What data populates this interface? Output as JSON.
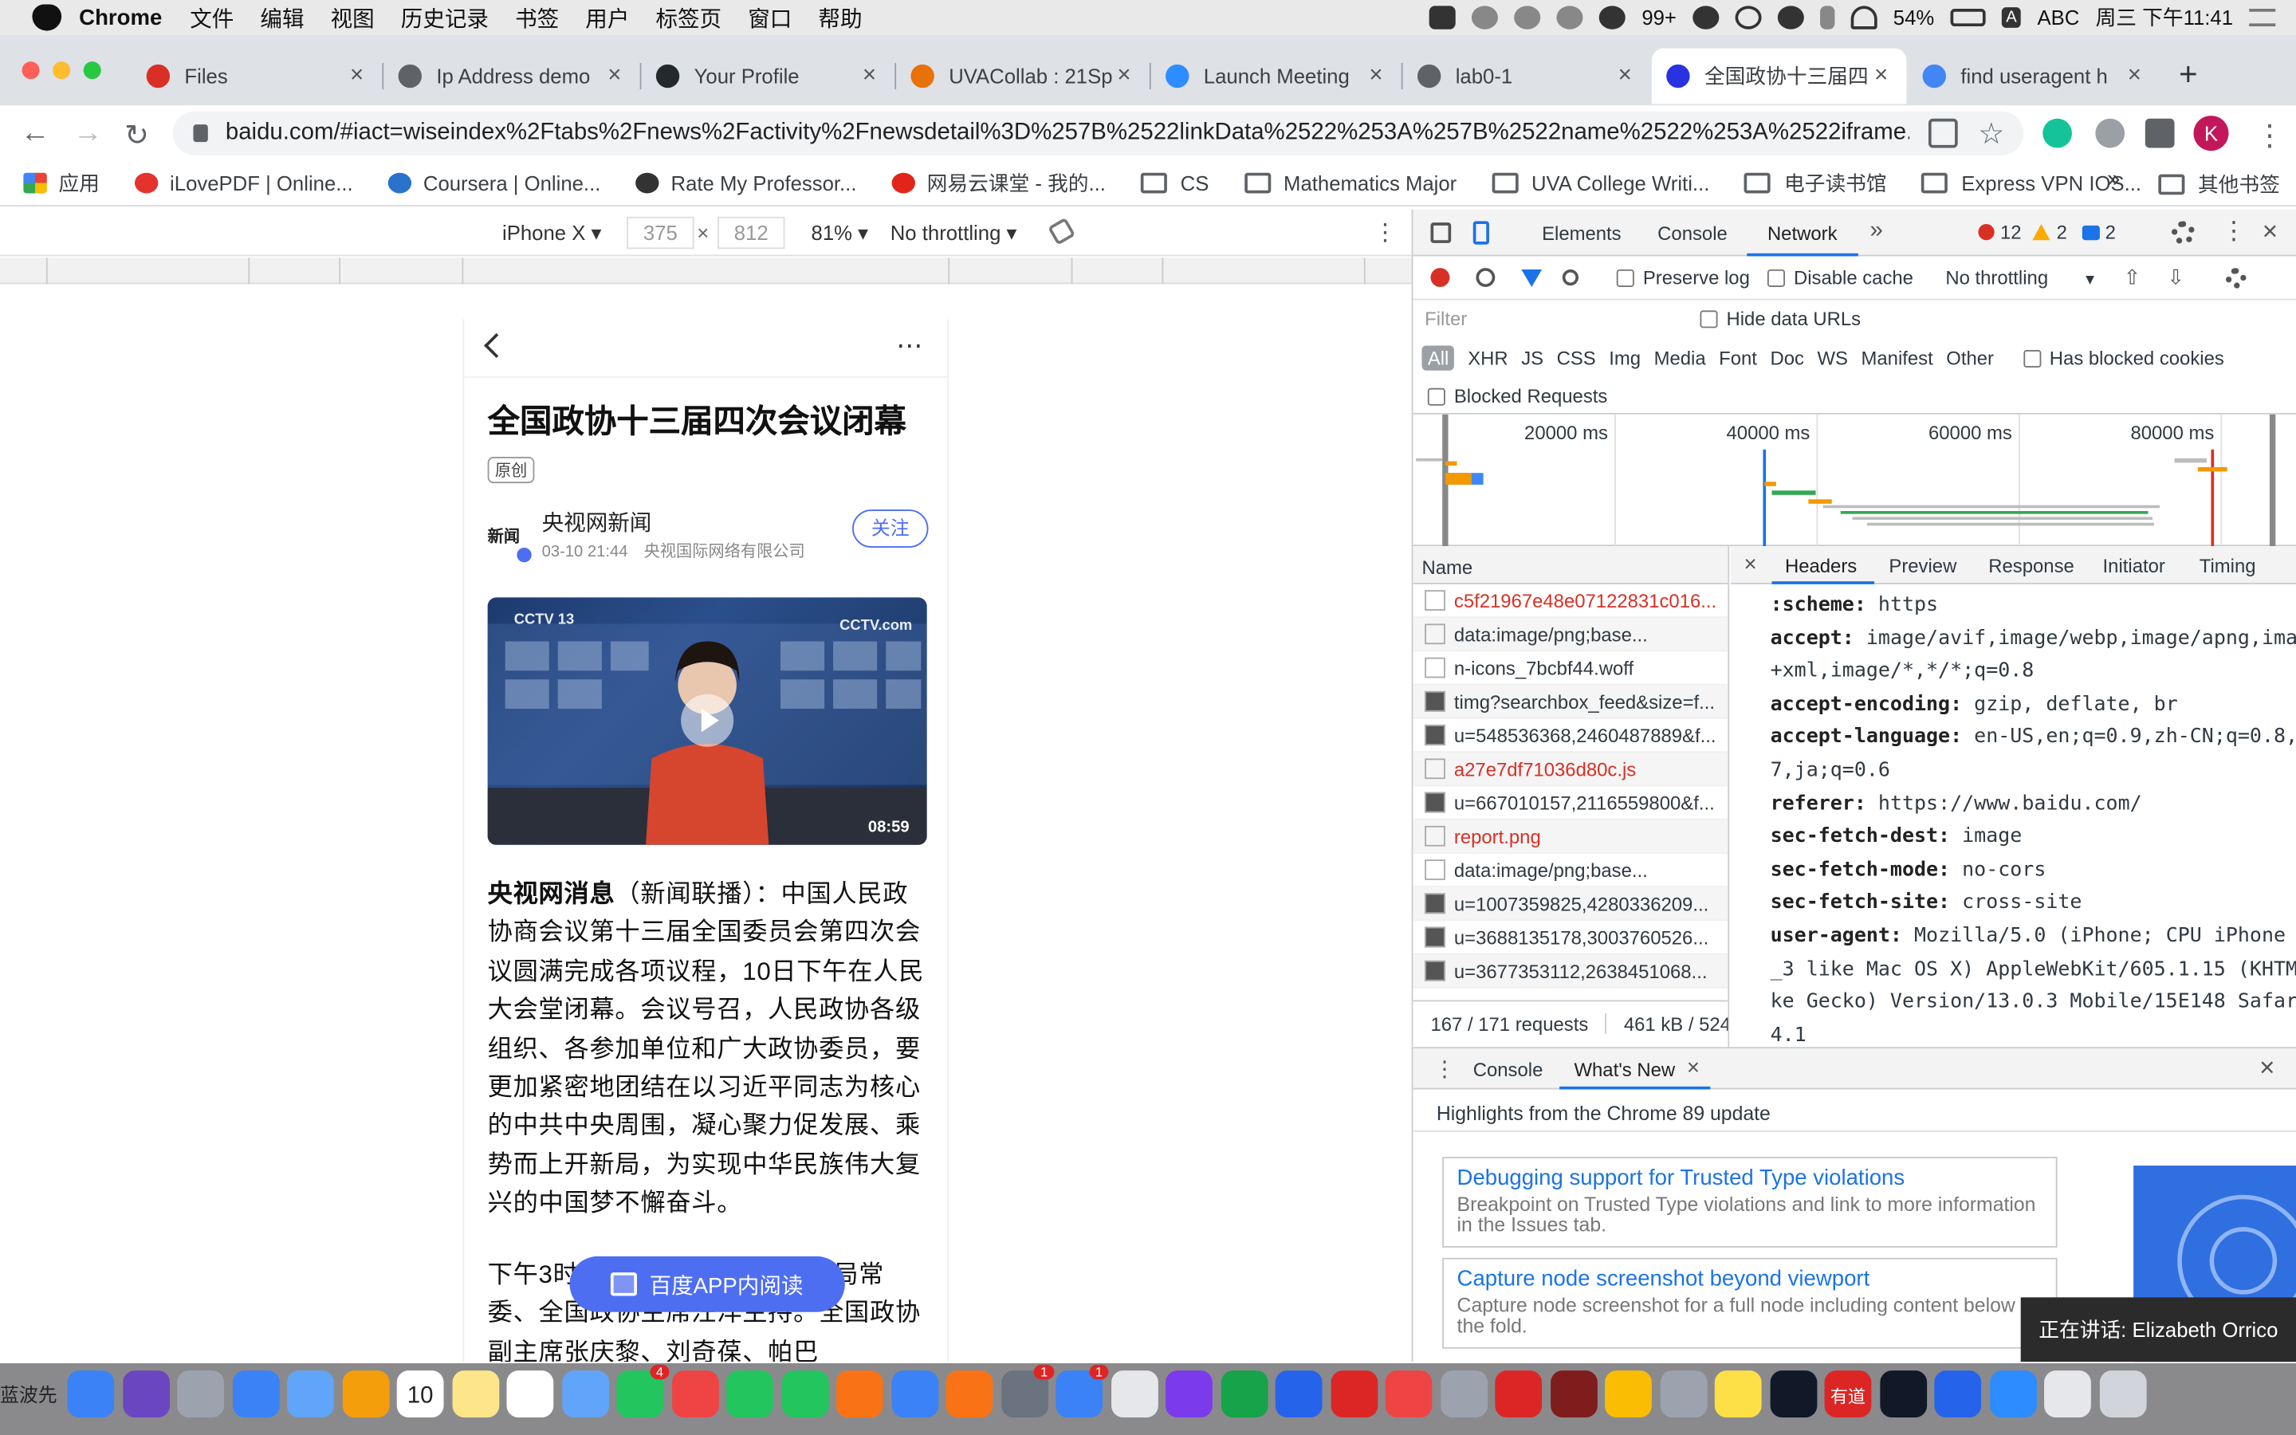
{
  "menubar": {
    "app": "Chrome",
    "items": [
      "文件",
      "编辑",
      "视图",
      "历史记录",
      "书签",
      "用户",
      "标签页",
      "窗口",
      "帮助"
    ],
    "wechat_badge": "99+",
    "battery": "54%",
    "input_method": "ABC",
    "clock": "周三 下午11:41"
  },
  "tabs": [
    {
      "title": "Files",
      "color": "#d93025"
    },
    {
      "title": "Ip Address demo",
      "color": "#5f6368"
    },
    {
      "title": "Your Profile",
      "color": "#24292e"
    },
    {
      "title": "UVACollab : 21Sp",
      "color": "#e8710a"
    },
    {
      "title": "Launch Meeting",
      "color": "#2d8cff"
    },
    {
      "title": "lab0-1",
      "color": "#5f6368"
    },
    {
      "title": "全国政协十三届四",
      "color": "#2932e1"
    },
    {
      "title": "find useragent h",
      "color": "#4285f4"
    }
  ],
  "omnibox": {
    "url": "baidu.com/#iact=wiseindex%2Ftabs%2Fnews%2Factivity%2Fnewsdetail%3D%257B%2522linkData%2522%253A%257B%2522name%2522%253A%2522iframe..."
  },
  "profile_initial": "K",
  "bookmarks": [
    {
      "label": "应用",
      "type": "apps"
    },
    {
      "label": "iLovePDF | Online...",
      "type": "site",
      "color": "#e5322d"
    },
    {
      "label": "Coursera | Online...",
      "type": "site",
      "color": "#2a73cc"
    },
    {
      "label": "Rate My Professor...",
      "type": "site",
      "color": "#333333"
    },
    {
      "label": "网易云课堂 - 我的...",
      "type": "site",
      "color": "#e1251b"
    },
    {
      "label": "CS",
      "type": "folder"
    },
    {
      "label": "Mathematics Major",
      "type": "folder"
    },
    {
      "label": "UVA College Writi...",
      "type": "folder"
    },
    {
      "label": "电子读书馆",
      "type": "folder"
    },
    {
      "label": "Express VPN IOS...",
      "type": "folder"
    }
  ],
  "bookmarks_more": "»",
  "other_bookmarks": "其他书签",
  "device_toolbar": {
    "device": "iPhone X ▾",
    "width": "375",
    "height": "812",
    "zoom": "81% ▾",
    "throttle": "No throttling ▾",
    "times": "×"
  },
  "article": {
    "title": "全国政协十三届四次会议闭幕",
    "badge": "原创",
    "author": "央视网新闻",
    "logo_text": "新闻",
    "meta": "03-10 21:44　央视国际网络有限公司",
    "follow": "关注",
    "video_duration": "08:59",
    "channel_logo": "CCTV 13",
    "watermark": "CCTV.com",
    "lead_bold": "央视网消息",
    "lead_rest": "（新闻联播）：中国人民政协商会议第十三届全国委员会第四次会议圆满完成各项议程，10日下午在人民大会堂闭幕。会议号召，人民政协各级组织、各参加单位和广大政协委员，要更加紧密地团结在以习近平同志为核心的中共中央周围，凝心聚力促发展、乘势而上开新局，为实现中华民族伟大复兴的中国梦不懈奋斗。",
    "para2": "下午3时，大会在中共中央政治局常委、全国政协主席汪洋主持。全国政协副主席张庆黎、刘奇葆、帕巴",
    "app_button": "百度APP内阅读"
  },
  "devtools": {
    "tabs": [
      "Elements",
      "Console",
      "Network"
    ],
    "active_tab": "Network",
    "errors": "12",
    "warnings": "2",
    "messages": "2",
    "preserve_log": "Preserve log",
    "disable_cache": "Disable cache",
    "throttling": "No throttling",
    "filter_placeholder": "Filter",
    "hide_data_urls": "Hide data URLs",
    "types": [
      "All",
      "XHR",
      "JS",
      "CSS",
      "Img",
      "Media",
      "Font",
      "Doc",
      "WS",
      "Manifest",
      "Other"
    ],
    "has_blocked_cookies": "Has blocked cookies",
    "blocked_requests": "Blocked Requests",
    "timeline_labels": [
      "20000 ms",
      "40000 ms",
      "60000 ms",
      "80000 ms"
    ],
    "name_header": "Name",
    "requests": [
      {
        "name": "c5f21967e48e07122831c016...",
        "error": true
      },
      {
        "name": "data:image/png;base...",
        "error": false
      },
      {
        "name": "n-icons_7bcbf44.woff",
        "error": false
      },
      {
        "name": "timg?searchbox_feed&size=f...",
        "error": false
      },
      {
        "name": "u=548536368,2460487889&f...",
        "error": false
      },
      {
        "name": "a27e7df71036d80c.js",
        "error": true
      },
      {
        "name": "u=667010157,2116559800&f...",
        "error": false
      },
      {
        "name": "report.png",
        "error": true
      },
      {
        "name": "data:image/png;base...",
        "error": false
      },
      {
        "name": "u=1007359825,4280336209...",
        "error": false
      },
      {
        "name": "u=3688135178,3003760526...",
        "error": false
      },
      {
        "name": "u=3677353112,2638451068...",
        "error": false
      }
    ],
    "status": "167 / 171 requests",
    "transferred": "461 kB / 524",
    "detail_tabs": [
      "Headers",
      "Preview",
      "Response",
      "Initiator",
      "Timing"
    ],
    "detail_close": "×",
    "headers": [
      {
        "k": ":scheme:",
        "v": "https"
      },
      {
        "k": "accept:",
        "v": "image/avif,image/webp,image/apng,image/"
      },
      {
        "k": "",
        "v": "+xml,image/*,*/*;q=0.8"
      },
      {
        "k": "accept-encoding:",
        "v": "gzip, deflate, br"
      },
      {
        "k": "accept-language:",
        "v": "en-US,en;q=0.9,zh-CN;q=0.8,zh;q"
      },
      {
        "k": "",
        "v": "7,ja;q=0.6"
      },
      {
        "k": "referer:",
        "v": "https://www.baidu.com/"
      },
      {
        "k": "sec-fetch-dest:",
        "v": "image"
      },
      {
        "k": "sec-fetch-mode:",
        "v": "no-cors"
      },
      {
        "k": "sec-fetch-site:",
        "v": "cross-site"
      },
      {
        "k": "user-agent:",
        "v": "Mozilla/5.0 (iPhone; CPU iPhone OS 1"
      },
      {
        "k": "",
        "v": "_3 like Mac OS X) AppleWebKit/605.1.15 (KHTML,"
      },
      {
        "k": "",
        "v": "ke Gecko) Version/13.0.3 Mobile/15E148 Safari/"
      },
      {
        "k": "",
        "v": "4.1"
      }
    ],
    "drawer": {
      "tabs": [
        "Console",
        "What's New"
      ],
      "close_x": "×",
      "highlights": "Highlights from the Chrome 89 update",
      "cards": [
        {
          "title": "Debugging support for Trusted Type violations",
          "desc": "Breakpoint on Trusted Type violations and link to more information in the Issues tab."
        },
        {
          "title": "Capture node screenshot beyond viewport",
          "desc": "Capture node screenshot for a full node including content below the fold."
        }
      ]
    }
  },
  "toast": "正在讲话: Elizabeth Orrico",
  "dock_left_text": "蓝波先",
  "calendar_day": "10",
  "dock_badges": {
    "facetime": "4",
    "appstore": "1",
    "prefs": "1"
  },
  "dock_apps": [
    "Finder",
    "Siri",
    "Launchpad",
    "Safari",
    "Preview",
    "Photos",
    "Calendar",
    "Notes",
    "Reminders",
    "Messages",
    "FaceTime",
    "Music",
    "Numbers",
    "WeChat",
    "Pages",
    "Keynote",
    "Books",
    "System Preferences",
    "App Store",
    "Maps",
    "OneNote",
    "Excel",
    "Word",
    "Acrobat",
    "Rename",
    "Contacts",
    "PowerPoint",
    "Rar",
    "Chrome",
    "Rocket",
    "Stickies",
    "Cisco",
    "Youdao",
    "Terminal",
    "Zoom",
    "Zoom Meetings",
    "Preview Files",
    "Trash"
  ],
  "dock_youdao_label": "有道"
}
